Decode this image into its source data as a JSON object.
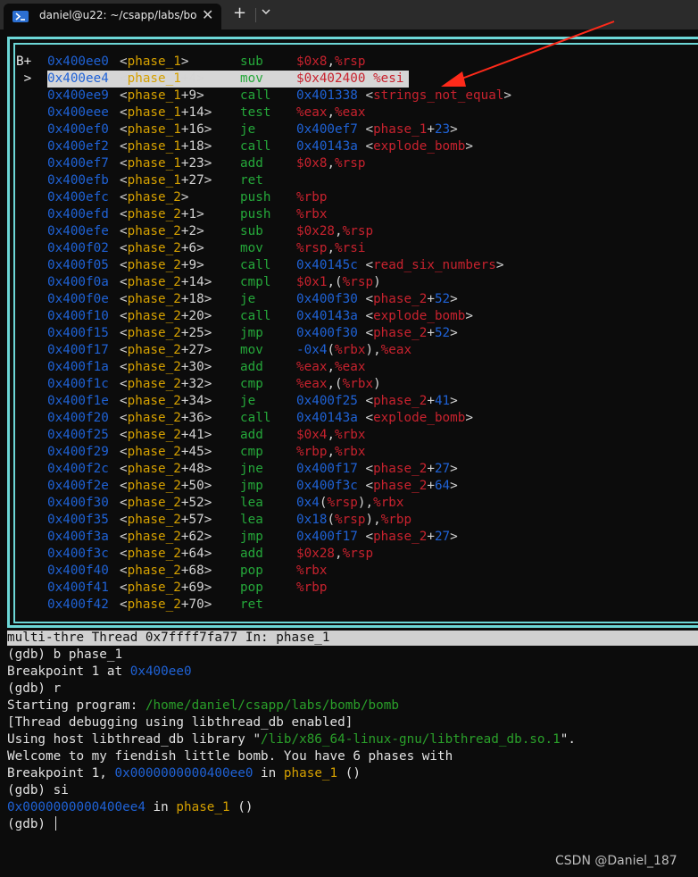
{
  "tab": {
    "title": "daniel@u22: ~/csapp/labs/bo",
    "close": "✕",
    "new_tab": "+"
  },
  "asm_rows": [
    {
      "mark": "B+",
      "addr": "0x400ee0",
      "fn": "phase_1",
      "off": "",
      "mn": "sub",
      "ops": [
        [
          "num",
          "$0x8"
        ],
        [
          "pt",
          ","
        ],
        [
          "reg",
          "%rsp"
        ]
      ]
    },
    {
      "mark": " >",
      "addr": "0x400ee4",
      "fn": "phase_1",
      "off": "+4",
      "mn": "mov",
      "ops": [
        [
          "num",
          "$0x402400"
        ],
        [
          "pt",
          ","
        ],
        [
          "reg",
          "%esi"
        ]
      ],
      "highlight": true
    },
    {
      "mark": "",
      "addr": "0x400ee9",
      "fn": "phase_1",
      "off": "+9",
      "mn": "call",
      "ops": [
        [
          "hexa",
          "0x401338 "
        ],
        [
          "br",
          "<"
        ],
        [
          "tsym",
          "strings_not_equal"
        ],
        [
          "br",
          ">"
        ]
      ]
    },
    {
      "mark": "",
      "addr": "0x400eee",
      "fn": "phase_1",
      "off": "+14",
      "mn": "test",
      "ops": [
        [
          "reg",
          "%eax"
        ],
        [
          "pt",
          ","
        ],
        [
          "reg",
          "%eax"
        ]
      ]
    },
    {
      "mark": "",
      "addr": "0x400ef0",
      "fn": "phase_1",
      "off": "+16",
      "mn": "je",
      "ops": [
        [
          "hexa",
          "0x400ef7 "
        ],
        [
          "br",
          "<"
        ],
        [
          "tsym",
          "phase_1"
        ],
        [
          "br",
          "+"
        ],
        [
          "hexa",
          "23"
        ],
        [
          "br",
          ">"
        ]
      ]
    },
    {
      "mark": "",
      "addr": "0x400ef2",
      "fn": "phase_1",
      "off": "+18",
      "mn": "call",
      "ops": [
        [
          "hexa",
          "0x40143a "
        ],
        [
          "br",
          "<"
        ],
        [
          "tsym",
          "explode_bomb"
        ],
        [
          "br",
          ">"
        ]
      ]
    },
    {
      "mark": "",
      "addr": "0x400ef7",
      "fn": "phase_1",
      "off": "+23",
      "mn": "add",
      "ops": [
        [
          "num",
          "$0x8"
        ],
        [
          "pt",
          ","
        ],
        [
          "reg",
          "%rsp"
        ]
      ]
    },
    {
      "mark": "",
      "addr": "0x400efb",
      "fn": "phase_1",
      "off": "+27",
      "mn": "ret",
      "ops": []
    },
    {
      "mark": "",
      "addr": "0x400efc",
      "fn": "phase_2",
      "off": "",
      "mn": "push",
      "ops": [
        [
          "reg",
          "%rbp"
        ]
      ]
    },
    {
      "mark": "",
      "addr": "0x400efd",
      "fn": "phase_2",
      "off": "+1",
      "mn": "push",
      "ops": [
        [
          "reg",
          "%rbx"
        ]
      ]
    },
    {
      "mark": "",
      "addr": "0x400efe",
      "fn": "phase_2",
      "off": "+2",
      "mn": "sub",
      "ops": [
        [
          "num",
          "$0x28"
        ],
        [
          "pt",
          ","
        ],
        [
          "reg",
          "%rsp"
        ]
      ]
    },
    {
      "mark": "",
      "addr": "0x400f02",
      "fn": "phase_2",
      "off": "+6",
      "mn": "mov",
      "ops": [
        [
          "reg",
          "%rsp"
        ],
        [
          "pt",
          ","
        ],
        [
          "reg",
          "%rsi"
        ]
      ]
    },
    {
      "mark": "",
      "addr": "0x400f05",
      "fn": "phase_2",
      "off": "+9",
      "mn": "call",
      "ops": [
        [
          "hexa",
          "0x40145c "
        ],
        [
          "br",
          "<"
        ],
        [
          "tsym",
          "read_six_numbers"
        ],
        [
          "br",
          ">"
        ]
      ]
    },
    {
      "mark": "",
      "addr": "0x400f0a",
      "fn": "phase_2",
      "off": "+14",
      "mn": "cmpl",
      "ops": [
        [
          "num",
          "$0x1"
        ],
        [
          "pt",
          ",("
        ],
        [
          "reg",
          "%rsp"
        ],
        [
          "pt",
          ")"
        ]
      ]
    },
    {
      "mark": "",
      "addr": "0x400f0e",
      "fn": "phase_2",
      "off": "+18",
      "mn": "je",
      "ops": [
        [
          "hexa",
          "0x400f30 "
        ],
        [
          "br",
          "<"
        ],
        [
          "tsym",
          "phase_2"
        ],
        [
          "br",
          "+"
        ],
        [
          "hexa",
          "52"
        ],
        [
          "br",
          ">"
        ]
      ]
    },
    {
      "mark": "",
      "addr": "0x400f10",
      "fn": "phase_2",
      "off": "+20",
      "mn": "call",
      "ops": [
        [
          "hexa",
          "0x40143a "
        ],
        [
          "br",
          "<"
        ],
        [
          "tsym",
          "explode_bomb"
        ],
        [
          "br",
          ">"
        ]
      ]
    },
    {
      "mark": "",
      "addr": "0x400f15",
      "fn": "phase_2",
      "off": "+25",
      "mn": "jmp",
      "ops": [
        [
          "hexa",
          "0x400f30 "
        ],
        [
          "br",
          "<"
        ],
        [
          "tsym",
          "phase_2"
        ],
        [
          "br",
          "+"
        ],
        [
          "hexa",
          "52"
        ],
        [
          "br",
          ">"
        ]
      ]
    },
    {
      "mark": "",
      "addr": "0x400f17",
      "fn": "phase_2",
      "off": "+27",
      "mn": "mov",
      "ops": [
        [
          "hexa",
          "-0x4"
        ],
        [
          "pt",
          "("
        ],
        [
          "reg",
          "%rbx"
        ],
        [
          "pt",
          "),"
        ],
        [
          "reg",
          "%eax"
        ]
      ]
    },
    {
      "mark": "",
      "addr": "0x400f1a",
      "fn": "phase_2",
      "off": "+30",
      "mn": "add",
      "ops": [
        [
          "reg",
          "%eax"
        ],
        [
          "pt",
          ","
        ],
        [
          "reg",
          "%eax"
        ]
      ]
    },
    {
      "mark": "",
      "addr": "0x400f1c",
      "fn": "phase_2",
      "off": "+32",
      "mn": "cmp",
      "ops": [
        [
          "reg",
          "%eax"
        ],
        [
          "pt",
          ",("
        ],
        [
          "reg",
          "%rbx"
        ],
        [
          "pt",
          ")"
        ]
      ]
    },
    {
      "mark": "",
      "addr": "0x400f1e",
      "fn": "phase_2",
      "off": "+34",
      "mn": "je",
      "ops": [
        [
          "hexa",
          "0x400f25 "
        ],
        [
          "br",
          "<"
        ],
        [
          "tsym",
          "phase_2"
        ],
        [
          "br",
          "+"
        ],
        [
          "hexa",
          "41"
        ],
        [
          "br",
          ">"
        ]
      ]
    },
    {
      "mark": "",
      "addr": "0x400f20",
      "fn": "phase_2",
      "off": "+36",
      "mn": "call",
      "ops": [
        [
          "hexa",
          "0x40143a "
        ],
        [
          "br",
          "<"
        ],
        [
          "tsym",
          "explode_bomb"
        ],
        [
          "br",
          ">"
        ]
      ]
    },
    {
      "mark": "",
      "addr": "0x400f25",
      "fn": "phase_2",
      "off": "+41",
      "mn": "add",
      "ops": [
        [
          "num",
          "$0x4"
        ],
        [
          "pt",
          ","
        ],
        [
          "reg",
          "%rbx"
        ]
      ]
    },
    {
      "mark": "",
      "addr": "0x400f29",
      "fn": "phase_2",
      "off": "+45",
      "mn": "cmp",
      "ops": [
        [
          "reg",
          "%rbp"
        ],
        [
          "pt",
          ","
        ],
        [
          "reg",
          "%rbx"
        ]
      ]
    },
    {
      "mark": "",
      "addr": "0x400f2c",
      "fn": "phase_2",
      "off": "+48",
      "mn": "jne",
      "ops": [
        [
          "hexa",
          "0x400f17 "
        ],
        [
          "br",
          "<"
        ],
        [
          "tsym",
          "phase_2"
        ],
        [
          "br",
          "+"
        ],
        [
          "hexa",
          "27"
        ],
        [
          "br",
          ">"
        ]
      ]
    },
    {
      "mark": "",
      "addr": "0x400f2e",
      "fn": "phase_2",
      "off": "+50",
      "mn": "jmp",
      "ops": [
        [
          "hexa",
          "0x400f3c "
        ],
        [
          "br",
          "<"
        ],
        [
          "tsym",
          "phase_2"
        ],
        [
          "br",
          "+"
        ],
        [
          "hexa",
          "64"
        ],
        [
          "br",
          ">"
        ]
      ]
    },
    {
      "mark": "",
      "addr": "0x400f30",
      "fn": "phase_2",
      "off": "+52",
      "mn": "lea",
      "ops": [
        [
          "hexa",
          "0x4"
        ],
        [
          "pt",
          "("
        ],
        [
          "reg",
          "%rsp"
        ],
        [
          "pt",
          "),"
        ],
        [
          "reg",
          "%rbx"
        ]
      ]
    },
    {
      "mark": "",
      "addr": "0x400f35",
      "fn": "phase_2",
      "off": "+57",
      "mn": "lea",
      "ops": [
        [
          "hexa",
          "0x18"
        ],
        [
          "pt",
          "("
        ],
        [
          "reg",
          "%rsp"
        ],
        [
          "pt",
          "),"
        ],
        [
          "reg",
          "%rbp"
        ]
      ]
    },
    {
      "mark": "",
      "addr": "0x400f3a",
      "fn": "phase_2",
      "off": "+62",
      "mn": "jmp",
      "ops": [
        [
          "hexa",
          "0x400f17 "
        ],
        [
          "br",
          "<"
        ],
        [
          "tsym",
          "phase_2"
        ],
        [
          "br",
          "+"
        ],
        [
          "hexa",
          "27"
        ],
        [
          "br",
          ">"
        ]
      ]
    },
    {
      "mark": "",
      "addr": "0x400f3c",
      "fn": "phase_2",
      "off": "+64",
      "mn": "add",
      "ops": [
        [
          "num",
          "$0x28"
        ],
        [
          "pt",
          ","
        ],
        [
          "reg",
          "%rsp"
        ]
      ]
    },
    {
      "mark": "",
      "addr": "0x400f40",
      "fn": "phase_2",
      "off": "+68",
      "mn": "pop",
      "ops": [
        [
          "reg",
          "%rbx"
        ]
      ]
    },
    {
      "mark": "",
      "addr": "0x400f41",
      "fn": "phase_2",
      "off": "+69",
      "mn": "pop",
      "ops": [
        [
          "reg",
          "%rbp"
        ]
      ]
    },
    {
      "mark": "",
      "addr": "0x400f42",
      "fn": "phase_2",
      "off": "+70",
      "mn": "ret",
      "ops": []
    }
  ],
  "status_line": "multi-thre Thread 0x7ffff7fa77 In: phase_1",
  "console": [
    [
      [
        "t",
        "(gdb) b phase_1"
      ]
    ],
    [
      [
        "t",
        "Breakpoint 1 at "
      ],
      [
        "h",
        "0x400ee0"
      ]
    ],
    [
      [
        "t",
        "(gdb) r"
      ]
    ],
    [
      [
        "t",
        "Starting program: "
      ],
      [
        "p",
        "/home/daniel/csapp/labs/bomb/bomb"
      ]
    ],
    [
      [
        "t",
        "[Thread debugging using libthread_db enabled]"
      ]
    ],
    [
      [
        "t",
        "Using host libthread_db library \""
      ],
      [
        "p",
        "/lib/x86_64-linux-gnu/libthread_db.so.1"
      ],
      [
        "t",
        "\"."
      ]
    ],
    [
      [
        "t",
        "Welcome to my fiendish little bomb. You have 6 phases with"
      ]
    ],
    [
      [
        "t",
        "Breakpoint 1, "
      ],
      [
        "h",
        "0x0000000000400ee0"
      ],
      [
        "t",
        " in "
      ],
      [
        "f",
        "phase_1"
      ],
      [
        "t",
        " ()"
      ]
    ],
    [
      [
        "t",
        "(gdb) si"
      ]
    ],
    [
      [
        "h",
        "0x0000000000400ee4"
      ],
      [
        "t",
        " in "
      ],
      [
        "f",
        "phase_1"
      ],
      [
        "t",
        " ()"
      ]
    ],
    [
      [
        "t",
        "(gdb) "
      ]
    ]
  ],
  "watermark": "CSDN @Daniel_187",
  "colors": {
    "frame": "#6cd7d7",
    "arrow": "#ff2a1a"
  }
}
